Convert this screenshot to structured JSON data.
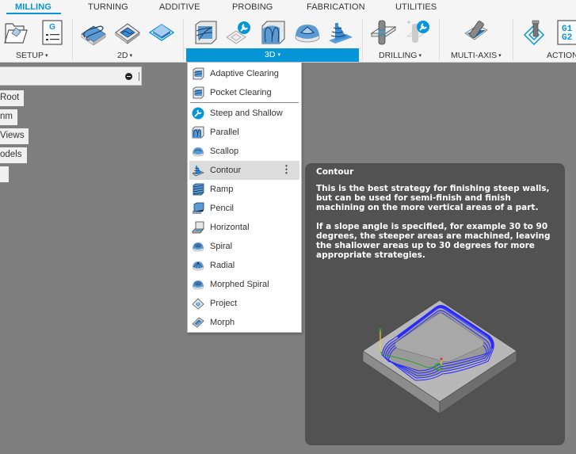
{
  "toolbar": {
    "tabs": [
      {
        "label": "MILLING",
        "active": true
      },
      {
        "label": "TURNING",
        "active": false
      },
      {
        "label": "ADDITIVE",
        "active": false
      },
      {
        "label": "PROBING",
        "active": false
      },
      {
        "label": "FABRICATION",
        "active": false
      },
      {
        "label": "UTILITIES",
        "active": false
      }
    ],
    "groups": [
      {
        "label": "SETUP",
        "tools": [
          "open-setup-folder-icon",
          "nc-program-g-icon"
        ]
      },
      {
        "label": "2D",
        "tools": [
          "2d-adaptive-icon",
          "2d-pocket-icon",
          "face-icon"
        ]
      },
      {
        "label": "3D",
        "active": true,
        "tools": [
          "adaptive-clearing-icon",
          "steep-shallow-icon",
          "parallel-icon",
          "scallop-icon",
          "contour-icon"
        ]
      },
      {
        "label": "DRILLING",
        "tools": [
          "drill-icon",
          "hole-recognition-icon"
        ]
      },
      {
        "label": "MULTI-AXIS",
        "tools": [
          "multi-axis-icon"
        ]
      },
      {
        "label": "ACTION",
        "tools": [
          "post-process-icon",
          "g1-g2-code-icon"
        ]
      }
    ],
    "caret": "▾",
    "gcode_icon_text": "G",
    "g1g2_text_1": "G1",
    "g1g2_text_2": "G2"
  },
  "browser": {
    "nodes": [
      "Root",
      "nm",
      " Views",
      "odels",
      ""
    ]
  },
  "menu": {
    "items": [
      {
        "label": "Adaptive Clearing",
        "icon": "adaptive-clearing-icon"
      },
      {
        "label": "Pocket Clearing",
        "icon": "pocket-clearing-icon"
      },
      {
        "label": "Steep and Shallow",
        "icon": "steep-and-shallow-icon"
      },
      {
        "label": "Parallel",
        "icon": "parallel-icon"
      },
      {
        "label": "Scallop",
        "icon": "scallop-icon"
      },
      {
        "label": "Contour",
        "icon": "contour-icon",
        "hovered": true
      },
      {
        "label": "Ramp",
        "icon": "ramp-icon"
      },
      {
        "label": "Pencil",
        "icon": "pencil-icon"
      },
      {
        "label": "Horizontal",
        "icon": "horizontal-icon"
      },
      {
        "label": "Spiral",
        "icon": "spiral-icon"
      },
      {
        "label": "Radial",
        "icon": "radial-icon"
      },
      {
        "label": "Morphed Spiral",
        "icon": "morphed-spiral-icon"
      },
      {
        "label": "Project",
        "icon": "project-icon"
      },
      {
        "label": "Morph",
        "icon": "morph-icon"
      }
    ],
    "more_glyph": "⋮"
  },
  "tooltip": {
    "title": "Contour",
    "paragraph_1": "This is the best strategy for finishing steep walls, but can be used for semi-finish and finish machining on the more vertical areas of a part.",
    "paragraph_2": "If a slope angle is specified, for example 30 to 90 degrees, the steeper areas are machined, leaving the shallower areas up to 30 degrees for more appropriate strategies."
  },
  "colors": {
    "accent": "#0696d7",
    "toolpath": "#2a2aff",
    "tooltip_bg": "#525252",
    "canvas_bg": "#7f7f7f"
  }
}
